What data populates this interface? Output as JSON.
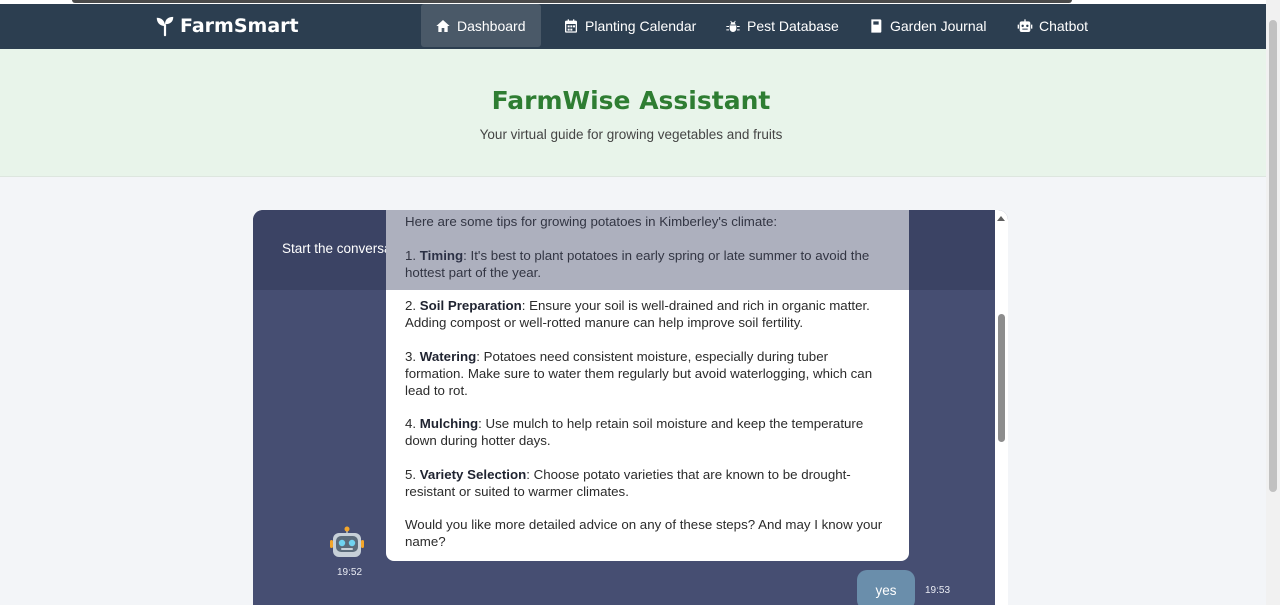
{
  "brand": {
    "name": "FarmSmart",
    "icon": "sprout-icon"
  },
  "nav": {
    "items": [
      {
        "label": "Dashboard",
        "icon": "home-icon",
        "active": true
      },
      {
        "label": "Planting Calendar",
        "icon": "calendar-icon",
        "active": false
      },
      {
        "label": "Pest Database",
        "icon": "bug-icon",
        "active": false
      },
      {
        "label": "Garden Journal",
        "icon": "journal-icon",
        "active": false
      },
      {
        "label": "Chatbot",
        "icon": "robot-icon",
        "active": false
      }
    ]
  },
  "hero": {
    "title": "FarmWise Assistant",
    "subtitle": "Your virtual guide for growing vegetables and fruits"
  },
  "chat": {
    "header_text": "Start the conversation",
    "bot_message": {
      "intro": "Here are some tips for growing potatoes in Kimberley's climate:",
      "tips": [
        {
          "num": "1. ",
          "title": "Timing",
          "text": ": It's best to plant potatoes in early spring or late summer to avoid the hottest part of the year."
        },
        {
          "num": "2. ",
          "title": "Soil Preparation",
          "text": ": Ensure your soil is well-drained and rich in organic matter. Adding compost or well-rotted manure can help improve soil fertility."
        },
        {
          "num": "3. ",
          "title": "Watering",
          "text": ": Potatoes need consistent moisture, especially during tuber formation. Make sure to water them regularly but avoid waterlogging, which can lead to rot."
        },
        {
          "num": "4. ",
          "title": "Mulching",
          "text": ": Use mulch to help retain soil moisture and keep the temperature down during hotter days."
        },
        {
          "num": "5. ",
          "title": "Variety Selection",
          "text": ": Choose potato varieties that are known to be drought-resistant or suited to warmer climates."
        }
      ],
      "closing": "Would you like more detailed advice on any of these steps? And may I know your name?",
      "time": "19:52",
      "avatar": "robot-emoji"
    },
    "user_message": {
      "text": "yes",
      "time": "19:53"
    }
  },
  "colors": {
    "navbar": "#2c3e50",
    "hero_bg": "#e8f4ea",
    "title_green": "#2e7d32",
    "chat_bg": "#464e72",
    "user_bubble": "#6a8eab"
  }
}
